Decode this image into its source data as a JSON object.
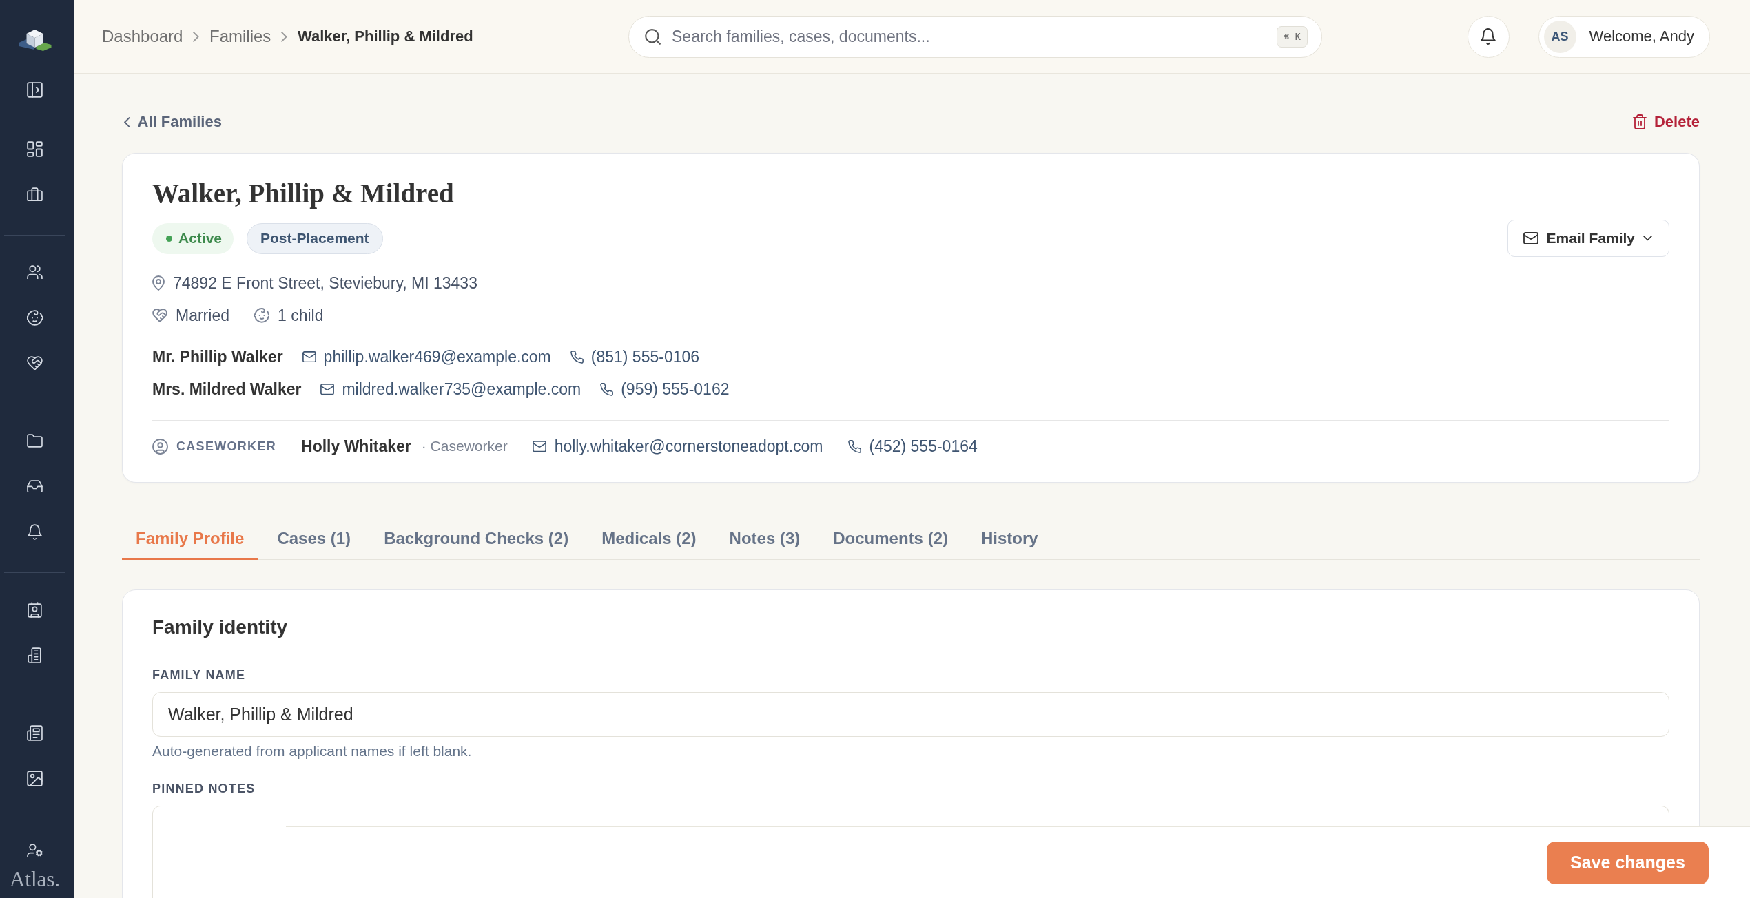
{
  "sidebar": {
    "brand": "Atlas."
  },
  "topbar": {
    "breadcrumbs": [
      {
        "label": "Dashboard",
        "current": false
      },
      {
        "label": "Families",
        "current": false
      },
      {
        "label": "Walker, Phillip & Mildred",
        "current": true
      }
    ],
    "search": {
      "placeholder": "Search families, cases, documents...",
      "shortcut": "⌘ K"
    },
    "user": {
      "initials": "AS",
      "greeting": "Welcome, Andy"
    }
  },
  "page_actions": {
    "back_link": "All Families",
    "delete_button": "Delete"
  },
  "family": {
    "title": "Walker, Phillip & Mildred",
    "badges": [
      {
        "kind": "status",
        "label": "Active"
      },
      {
        "kind": "tag",
        "label": "Post-Placement"
      }
    ],
    "email_button": "Email Family",
    "address": "74892 E Front Street, Steviebury, MI 13433",
    "marital_status": "Married",
    "children": "1 child",
    "applicants": [
      {
        "name": "Mr. Phillip Walker",
        "email": "phillip.walker469@example.com",
        "phone": "(851) 555-0106"
      },
      {
        "name": "Mrs. Mildred Walker",
        "email": "mildred.walker735@example.com",
        "phone": "(959) 555-0162"
      }
    ],
    "caseworker": {
      "label": "CASEWORKER",
      "name": "Holly Whitaker",
      "role": "· Caseworker",
      "email": "holly.whitaker@cornerstoneadopt.com",
      "phone": "(452) 555-0164"
    }
  },
  "tabs": [
    {
      "label": "Family Profile",
      "selected": true
    },
    {
      "label": "Cases (1)",
      "selected": false
    },
    {
      "label": "Background Checks (2)",
      "selected": false
    },
    {
      "label": "Medicals (2)",
      "selected": false
    },
    {
      "label": "Notes (3)",
      "selected": false
    },
    {
      "label": "Documents (2)",
      "selected": false
    },
    {
      "label": "History",
      "selected": false
    }
  ],
  "identity_form": {
    "title": "Family identity",
    "fields": [
      {
        "kind": "text",
        "label": "FAMILY NAME",
        "value": "Walker, Phillip & Mildred",
        "help": "Auto-generated from applicant names if left blank."
      },
      {
        "kind": "textarea",
        "label": "PINNED NOTES"
      }
    ]
  },
  "save_button": "Save changes"
}
